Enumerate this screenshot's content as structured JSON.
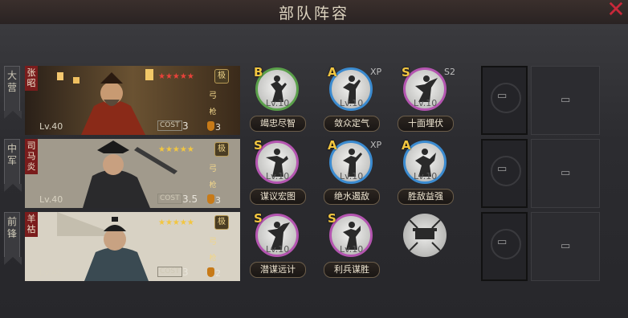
{
  "title": "部队阵容",
  "close_label": "✕",
  "rows": [
    {
      "position": "大营",
      "general": {
        "name": "张昭",
        "level": "Lv.40",
        "stars": "★★★★★",
        "star_color": "#e8423a",
        "cost_label": "COST",
        "cost": "3",
        "troops": "3",
        "badge1": "极",
        "badge2": "弓",
        "badge3": "枪"
      },
      "skills": [
        {
          "grade": "B",
          "tag": "",
          "level": "Lv.10",
          "name": "竭忠尽智",
          "ring": "g"
        },
        {
          "grade": "A",
          "tag": "XP",
          "level": "Lv.10",
          "name": "敛众定气",
          "ring": "b"
        },
        {
          "grade": "S",
          "tag": "S2",
          "level": "Lv.10",
          "name": "十面埋伏",
          "ring": "p"
        }
      ]
    },
    {
      "position": "中军",
      "general": {
        "name": "司马炎",
        "level": "Lv.40",
        "stars": "★★★★★",
        "star_color": "#f2c640",
        "cost_label": "COST",
        "cost": "3.5",
        "troops": "3",
        "badge1": "极",
        "badge2": "弓",
        "badge3": "枪"
      },
      "skills": [
        {
          "grade": "S",
          "tag": "",
          "level": "Lv.10",
          "name": "谋议宏图",
          "ring": "p"
        },
        {
          "grade": "A",
          "tag": "XP",
          "level": "Lv.10",
          "name": "绝水遏敌",
          "ring": "b"
        },
        {
          "grade": "A",
          "tag": "",
          "level": "Lv.10",
          "name": "胜敌益强",
          "ring": "b"
        }
      ]
    },
    {
      "position": "前锋",
      "general": {
        "name": "羊祜",
        "level": "Lv.40",
        "stars": "★★★★★",
        "star_color": "#f2c640",
        "cost_label": "COST",
        "cost": "3",
        "troops": "2",
        "badge1": "极",
        "badge2": "弓",
        "badge3": "枪"
      },
      "skills": [
        {
          "grade": "S",
          "tag": "",
          "level": "Lv.10",
          "name": "潜谋远计",
          "ring": "p"
        },
        {
          "grade": "S",
          "tag": "",
          "level": "Lv.10",
          "name": "利兵谋胜",
          "ring": "p"
        }
      ]
    }
  ]
}
